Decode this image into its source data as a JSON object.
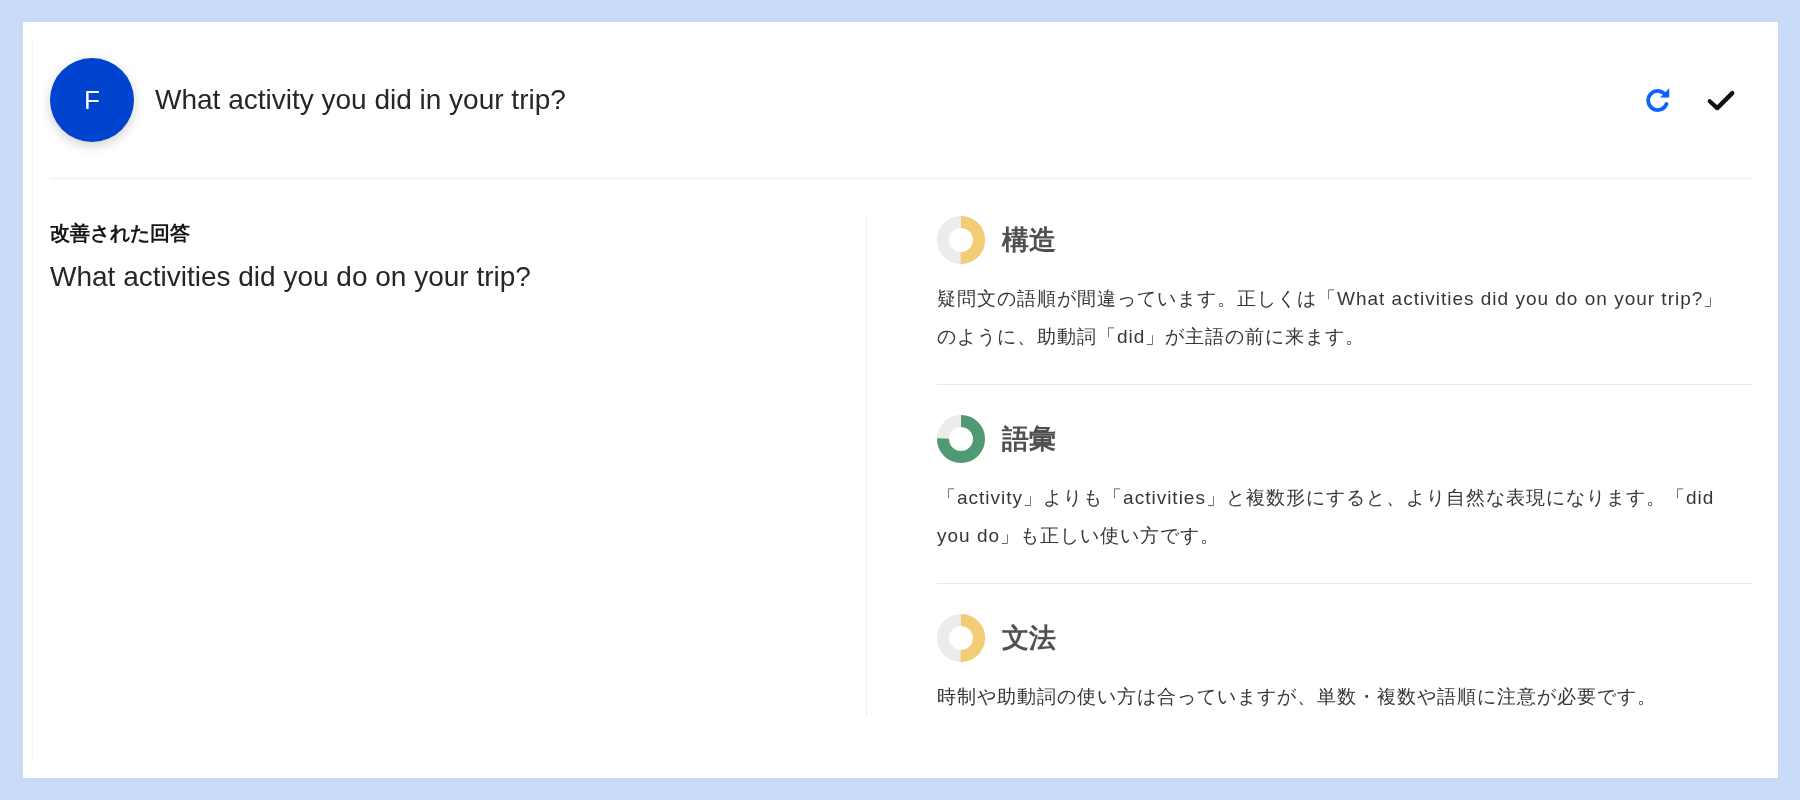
{
  "avatar": {
    "initial": "F"
  },
  "question": "What activity you did in your trip?",
  "improved_answer": {
    "label": "改善された回答",
    "text": "What activities did you do on your trip?"
  },
  "feedback": [
    {
      "title": "構造",
      "level": 0.5,
      "color": "#f3cd76",
      "text": "疑問文の語順が間違っています。正しくは「What activities did you do on your trip?」のように、助動詞「did」が主語の前に来ます。"
    },
    {
      "title": "語彙",
      "level": 0.75,
      "color": "#4f9a72",
      "text": "「activity」よりも「activities」と複数形にすると、より自然な表現になります。「did you do」も正しい使い方です。"
    },
    {
      "title": "文法",
      "level": 0.5,
      "color": "#f3cd76",
      "text": "時制や助動詞の使い方は合っていますが、単数・複数や語順に注意が必要です。"
    }
  ]
}
